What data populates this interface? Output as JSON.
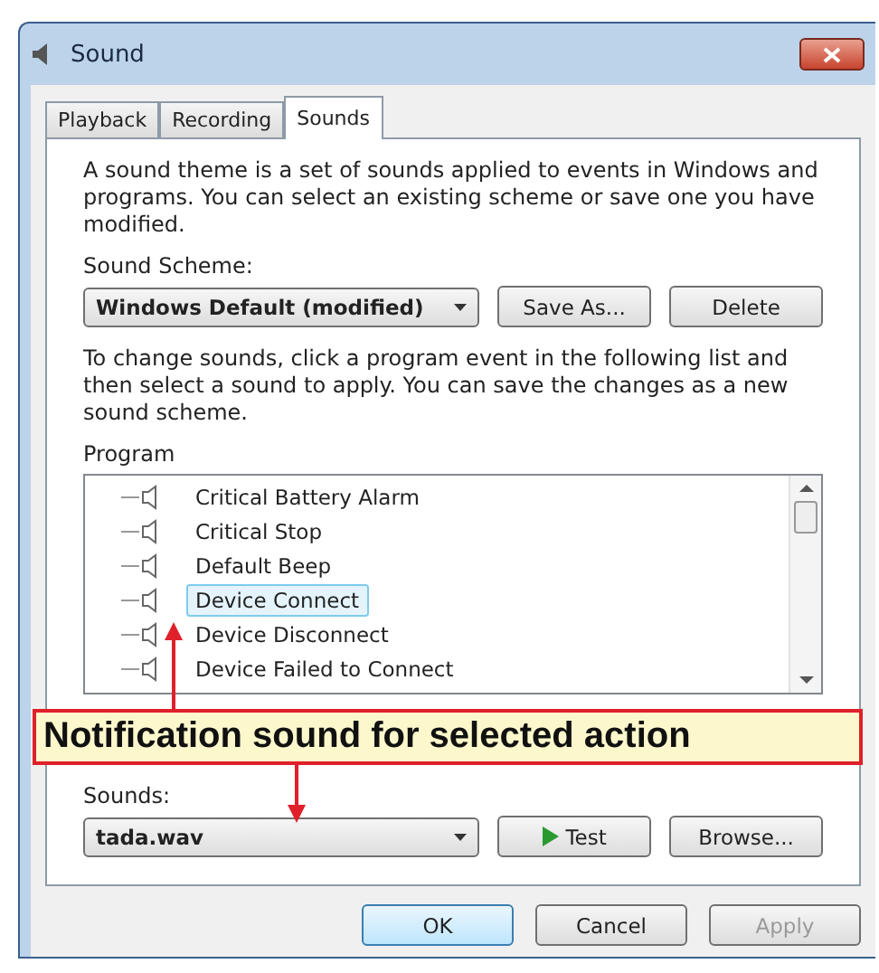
{
  "window": {
    "title": "Sound"
  },
  "tabs": [
    {
      "label": "Playback",
      "selected": false
    },
    {
      "label": "Recording",
      "selected": false
    },
    {
      "label": "Sounds",
      "selected": true
    }
  ],
  "description": "A sound theme is a set of sounds applied to events in Windows and programs.  You can select an existing scheme or save one you have modified.",
  "scheme": {
    "label": "Sound Scheme:",
    "value": "Windows Default (modified)",
    "buttons": [
      "Save As...",
      "Delete"
    ]
  },
  "instructions": "To change sounds, click a program event in the following list and then select a sound to apply.  You can save the changes as a new sound scheme.",
  "program": {
    "label": "Program",
    "events": [
      {
        "label": "Critical Battery Alarm",
        "selected": false
      },
      {
        "label": "Critical Stop",
        "selected": false
      },
      {
        "label": "Default Beep",
        "selected": false
      },
      {
        "label": "Device Connect",
        "selected": true
      },
      {
        "label": "Device Disconnect",
        "selected": false
      },
      {
        "label": "Device Failed to Connect",
        "selected": false
      }
    ]
  },
  "callout": {
    "text": "Notification sound for selected action"
  },
  "sounds": {
    "label": "Sounds:",
    "value": "tada.wav",
    "test": "Test",
    "browse": "Browse..."
  },
  "buttons": [
    {
      "label": "OK",
      "default": true,
      "disabled": false
    },
    {
      "label": "Cancel",
      "default": false,
      "disabled": false
    },
    {
      "label": "Apply",
      "default": false,
      "disabled": true
    }
  ]
}
